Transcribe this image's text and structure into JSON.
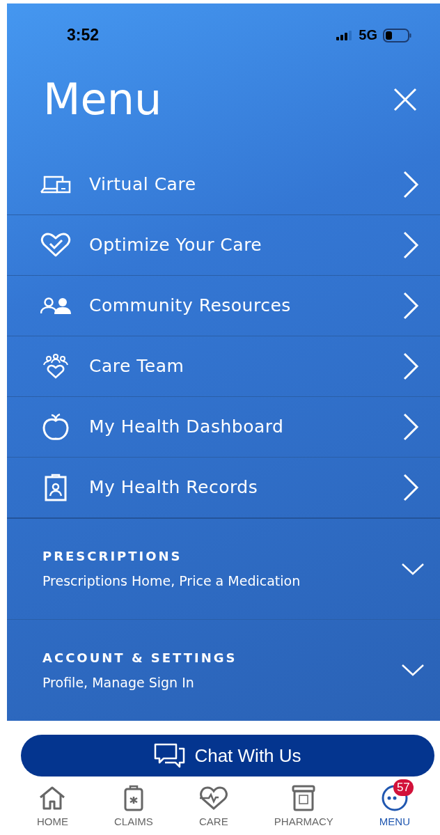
{
  "status_bar": {
    "time": "3:52",
    "network": "5G"
  },
  "title": "Menu",
  "items": [
    {
      "kind": "devices",
      "label": "Virtual Care"
    },
    {
      "kind": "heart",
      "label": "Optimize Your Care"
    },
    {
      "kind": "people",
      "label": "Community Resources"
    },
    {
      "kind": "team",
      "label": "Care Team"
    },
    {
      "kind": "apple",
      "label": "My Health Dashboard"
    },
    {
      "kind": "badge",
      "label": "My Health Records"
    }
  ],
  "sections": [
    {
      "title": "PRESCRIPTIONS",
      "subtitle": "Prescriptions Home, Price a Medication",
      "expanded": false
    },
    {
      "title": "ACCOUNT & SETTINGS",
      "subtitle": "Profile, Manage Sign In",
      "expanded": false
    }
  ],
  "chat_button": "Chat With Us",
  "tabs": [
    {
      "kind": "home",
      "label": "HOME",
      "selected": false
    },
    {
      "kind": "claims",
      "label": "CLAIMS",
      "selected": false
    },
    {
      "kind": "care",
      "label": "CARE",
      "selected": false
    },
    {
      "kind": "pharmacy",
      "label": "PHARMACY",
      "selected": false
    },
    {
      "kind": "menu",
      "label": "MENU",
      "selected": true,
      "badge": "57"
    }
  ]
}
